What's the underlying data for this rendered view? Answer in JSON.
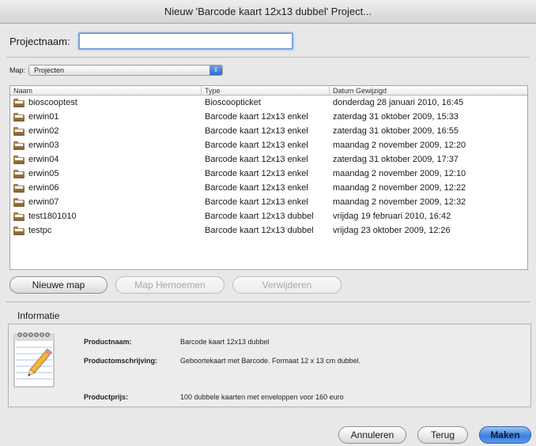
{
  "window": {
    "title": "Nieuw 'Barcode kaart 12x13 dubbel' Project..."
  },
  "project_name": {
    "label": "Projectnaam:",
    "value": "",
    "placeholder": ""
  },
  "map": {
    "label": "Map:",
    "selected": "Projecten"
  },
  "table": {
    "columns": [
      "Naam",
      "Type",
      "Datum Gewijzigd"
    ],
    "rows": [
      {
        "name": "bioscooptest",
        "type": "Bioscoopticket",
        "date": "donderdag 28 januari 2010, 16:45"
      },
      {
        "name": "erwin01",
        "type": "Barcode kaart 12x13 enkel",
        "date": "zaterdag 31 oktober 2009, 15:33"
      },
      {
        "name": "erwin02",
        "type": "Barcode kaart 12x13 enkel",
        "date": "zaterdag 31 oktober 2009, 16:55"
      },
      {
        "name": "erwin03",
        "type": "Barcode kaart 12x13 enkel",
        "date": "maandag 2 november 2009, 12:20"
      },
      {
        "name": "erwin04",
        "type": "Barcode kaart 12x13 enkel",
        "date": "zaterdag 31 oktober 2009, 17:37"
      },
      {
        "name": "erwin05",
        "type": "Barcode kaart 12x13 enkel",
        "date": "maandag 2 november 2009, 12:10"
      },
      {
        "name": "erwin06",
        "type": "Barcode kaart 12x13 enkel",
        "date": "maandag 2 november 2009, 12:22"
      },
      {
        "name": "erwin07",
        "type": "Barcode kaart 12x13 enkel",
        "date": "maandag 2 november 2009, 12:32"
      },
      {
        "name": "test1801010",
        "type": "Barcode kaart 12x13 dubbel",
        "date": "vrijdag 19 februari 2010, 16:42"
      },
      {
        "name": "testpc",
        "type": "Barcode kaart 12x13 dubbel",
        "date": "vrijdag 23 oktober 2009, 12:26"
      }
    ]
  },
  "folder_buttons": {
    "new": "Nieuwe map",
    "rename": "Map Hernoemen",
    "delete": "Verwijderen"
  },
  "info": {
    "title": "Informatie",
    "product_name_label": "Productnaam:",
    "product_name": "Barcode kaart 12x13 dubbel",
    "description_label": "Productomschrijving:",
    "description": "Geboortekaart met Barcode. Formaat 12 x 13 cm dubbel.",
    "price_label": "Productprijs:",
    "price": "100 dubbele kaarten met enveloppen voor 160 euro"
  },
  "actions": {
    "cancel": "Annuleren",
    "back": "Terug",
    "create": "Maken"
  }
}
